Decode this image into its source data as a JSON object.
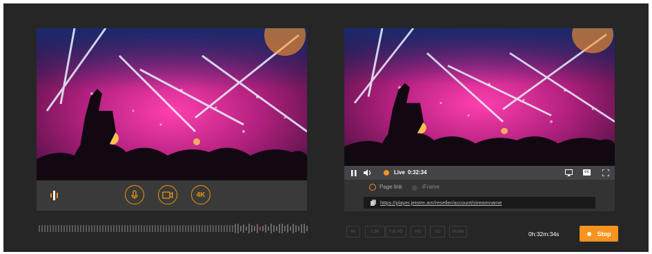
{
  "left_panel": {
    "controls": {
      "fourk_label": "4K"
    }
  },
  "right_panel": {
    "player": {
      "live_label": "Live",
      "timer": "0:32:34",
      "cc_label": "cc"
    },
    "share": {
      "option_page_link": "Page link",
      "option_iframe": "iFrame",
      "selected": "Page link",
      "url": "https://player.jetstre.am/reseller/account/streamname"
    }
  },
  "footer": {
    "quality_options": [
      "4K",
      "2.5K",
      "Full HD",
      "HD",
      "SD",
      "Mobile"
    ],
    "elapsed": "0h:32m:34s",
    "stop_label": "Stop"
  },
  "colors": {
    "accent": "#f7931e",
    "background": "#262626"
  }
}
